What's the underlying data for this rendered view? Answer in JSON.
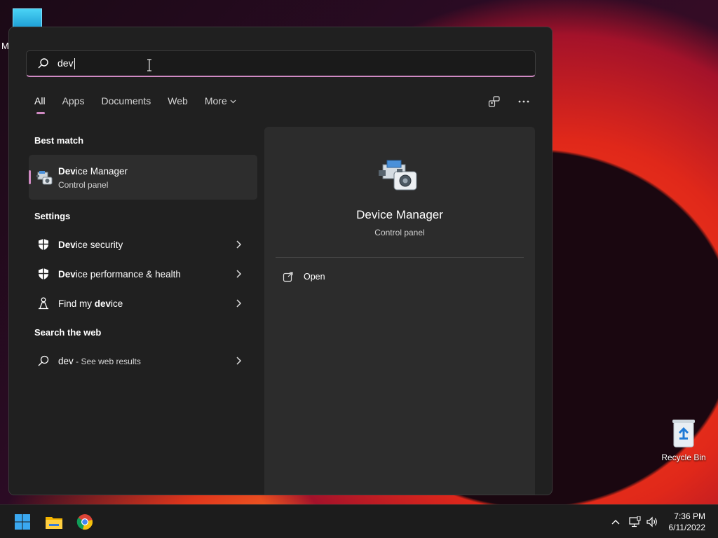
{
  "desktop": {
    "edge_letter": "M",
    "recycle_bin_label": "Recycle Bin"
  },
  "search": {
    "query": "dev",
    "icon": "search-icon"
  },
  "tabs": [
    {
      "label": "All",
      "active": true
    },
    {
      "label": "Apps",
      "active": false
    },
    {
      "label": "Documents",
      "active": false
    },
    {
      "label": "Web",
      "active": false
    },
    {
      "label": "More",
      "active": false
    }
  ],
  "top_icons": [
    "share-icon",
    "more-options-icon"
  ],
  "best_match": {
    "section_title": "Best match",
    "title_match": "Dev",
    "title_rest": "ice Manager",
    "subtitle": "Control panel",
    "icon": "device-manager-icon"
  },
  "settings": {
    "section_title": "Settings",
    "items": [
      {
        "match": "Dev",
        "rest": "ice security",
        "icon": "shield-icon"
      },
      {
        "match": "Dev",
        "rest": "ice performance & health",
        "icon": "shield-icon"
      },
      {
        "prefix": "Find my ",
        "match": "dev",
        "rest": "ice",
        "icon": "person-location-icon"
      }
    ]
  },
  "web": {
    "section_title": "Search the web",
    "query": "dev",
    "suffix": " - See web results",
    "icon": "search-icon"
  },
  "preview": {
    "title": "Device Manager",
    "subtitle": "Control panel",
    "open_label": "Open",
    "open_icon": "open-external-icon"
  },
  "taskbar": {
    "apps": [
      "windows-start-icon",
      "file-explorer-icon",
      "chrome-icon"
    ],
    "tray": [
      "chevron-up-icon",
      "network-icon",
      "volume-icon"
    ],
    "time": "7:36 PM",
    "date": "6/11/2022"
  },
  "colors": {
    "accent": "#d08ac3",
    "panel_bg": "#202020",
    "preview_bg": "#2c2c2c"
  }
}
